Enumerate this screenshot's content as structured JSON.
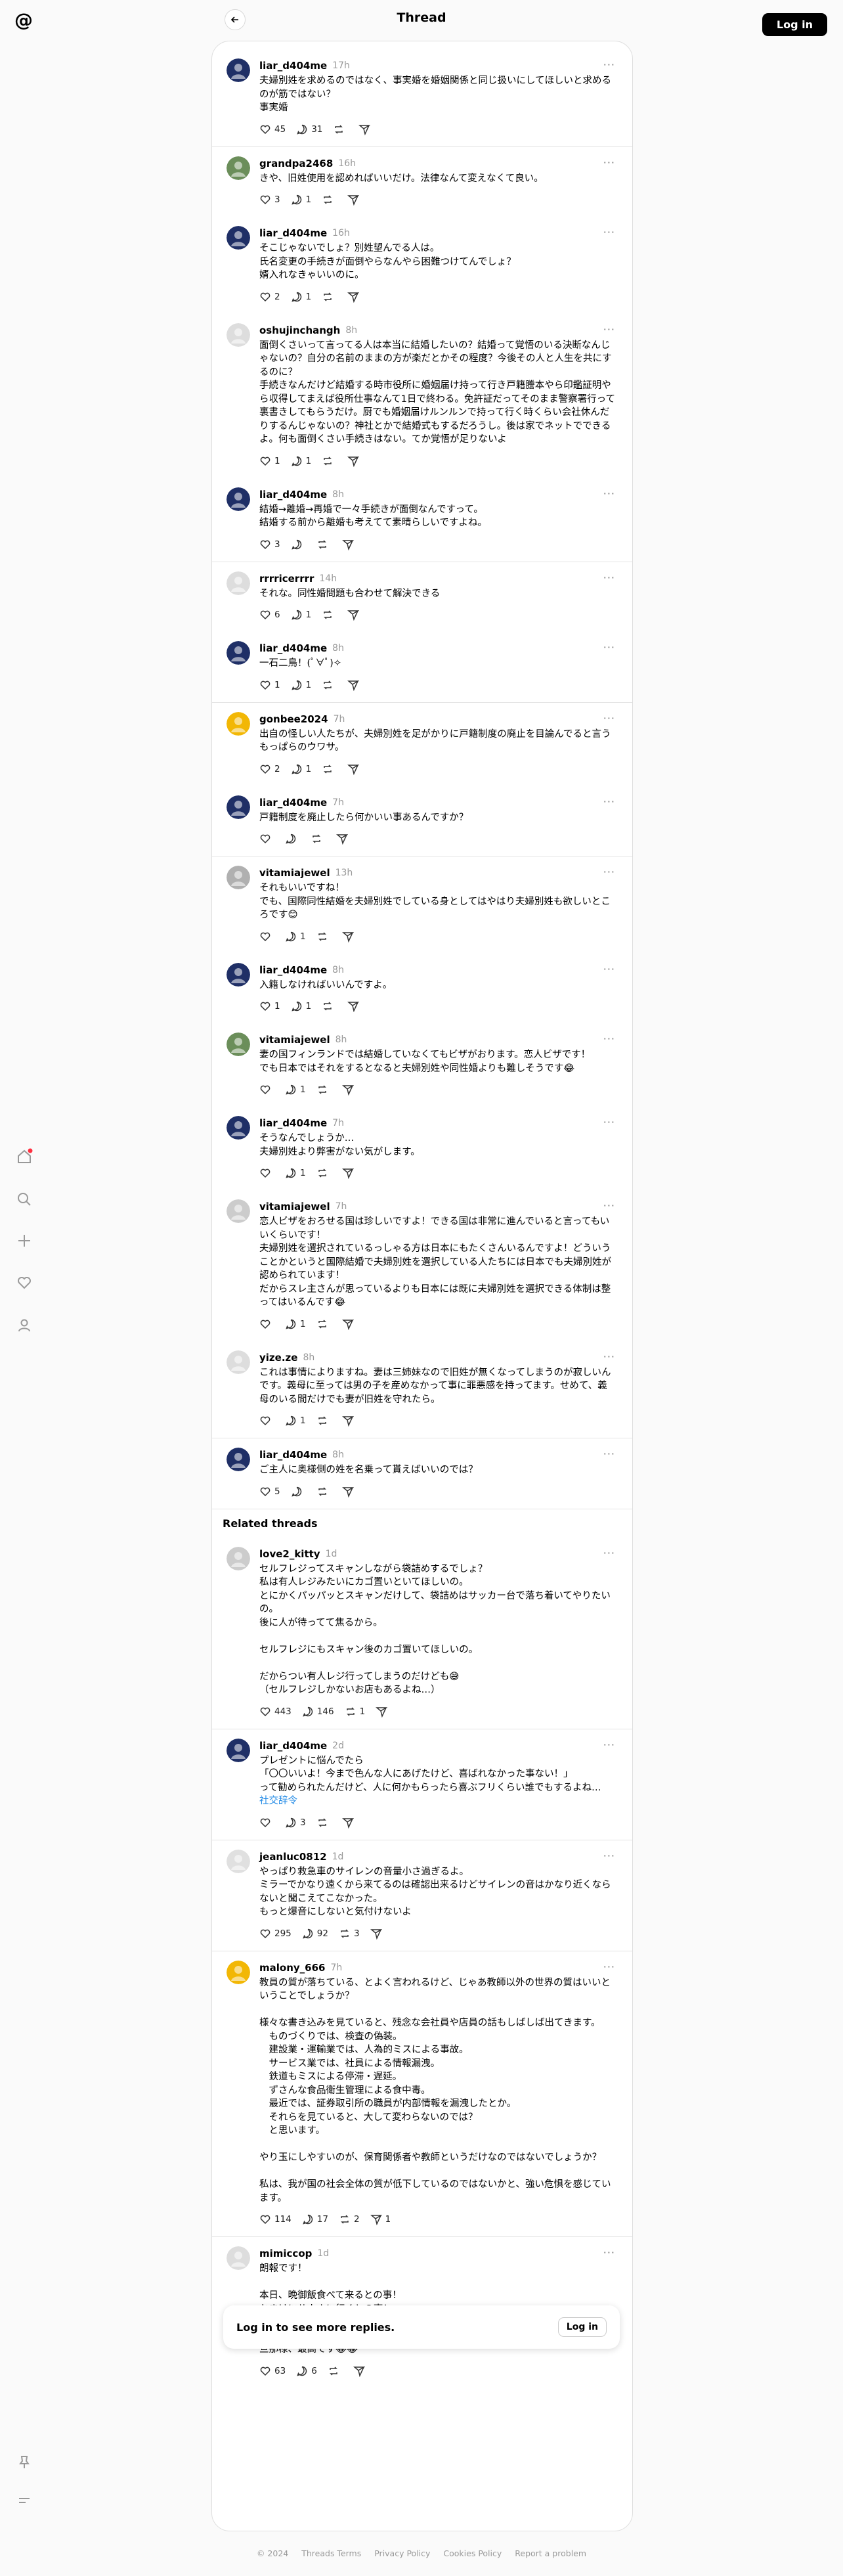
{
  "header": {
    "title": "Thread",
    "login_label": "Log in"
  },
  "colors": {
    "accent": "#000000",
    "link": "#1e88e5",
    "notification": "#ff3040"
  },
  "sidebar_icons": [
    "home-icon",
    "search-icon",
    "create-icon",
    "heart-icon",
    "profile-icon",
    "pin-icon",
    "menu-icon"
  ],
  "thread": [
    {
      "user": "liar_d404me",
      "time": "17h",
      "lines": [
        "夫婦別姓を求めるのではなく、事実婚を婚姻関係と同じ扱いにしてほしいと求めるのが筋ではない？",
        "事実婚"
      ],
      "likes": "45",
      "replies": "31",
      "reposts": "",
      "shares": ""
    },
    {
      "user": "grandpa2468",
      "time": "16h",
      "lines": [
        "きや、旧姓使用を認めればいいだけ。法律なんて変えなくて良い。"
      ],
      "likes": "3",
      "replies": "1",
      "reposts": "",
      "shares": ""
    },
    {
      "user": "liar_d404me",
      "time": "16h",
      "lines": [
        "そこじゃないでしょ？別姓望んでる人は。",
        "氏名変更の手続きが面倒やらなんやら困難つけてんでしょ？",
        "婿入れなきゃいいのに。"
      ],
      "likes": "2",
      "replies": "1",
      "reposts": "",
      "shares": ""
    },
    {
      "user": "oshujinchangh",
      "time": "8h",
      "lines": [
        "面倒くさいって言ってる人は本当に結婚したいの？結婚って覚悟のいる決断なんじゃないの？自分の名前のままの方が楽だとかその程度？今後その人と人生を共にするのに？",
        "手続きなんだけど結婚する時市役所に婚姻届け持って行き戸籍謄本やら印鑑証明やら収得してまえば役所仕事なんて1日で終わる。免許証だってそのまま警察署行って裏書きしてもらうだけ。厨でも婚姻届けルンルンで持って行く時くらい会社休んだりするんじゃないの？神社とかで結婚式もするだろうし。後は家でネットでできるよ。何も面倒くさい手続きはない。てか覚悟が足りないよ"
      ],
      "likes": "1",
      "replies": "1",
      "reposts": "",
      "shares": ""
    },
    {
      "user": "liar_d404me",
      "time": "8h",
      "lines": [
        "結婚→離婚→再婚で一々手続きが面倒なんですって。",
        "結婚する前から離婚も考えてて素晴らしいですよね。"
      ],
      "likes": "3",
      "replies": "",
      "reposts": "",
      "shares": ""
    },
    {
      "user": "rrrricerrrr",
      "time": "14h",
      "lines": [
        "それな。同性婚問題も合わせて解決できる"
      ],
      "likes": "6",
      "replies": "1",
      "reposts": "",
      "shares": ""
    },
    {
      "user": "liar_d404me",
      "time": "8h",
      "lines": [
        "一石二鳥！(ﾟ∀ﾟ)✧"
      ],
      "likes": "1",
      "replies": "1",
      "reposts": "",
      "shares": ""
    },
    {
      "user": "gonbee2024",
      "time": "7h",
      "lines": [
        "出自の怪しい人たちが、夫婦別姓を足がかりに戸籍制度の廃止を目論んでると言うもっぱらのウワサ。"
      ],
      "likes": "2",
      "replies": "1",
      "reposts": "",
      "shares": ""
    },
    {
      "user": "liar_d404me",
      "time": "7h",
      "lines": [
        "戸籍制度を廃止したら何かいい事あるんですか？"
      ],
      "likes": "",
      "replies": "",
      "reposts": "",
      "shares": ""
    },
    {
      "user": "vitamiajewel",
      "time": "13h",
      "lines": [
        "それもいいですね！",
        "でも、国際同性結婚を夫婦別姓でしている身としてはやはり夫婦別姓も欲しいところです😊"
      ],
      "likes": "",
      "replies": "1",
      "reposts": "",
      "shares": ""
    },
    {
      "user": "liar_d404me",
      "time": "8h",
      "lines": [
        "入籍しなければいいんですよ。"
      ],
      "likes": "1",
      "replies": "1",
      "reposts": "",
      "shares": ""
    },
    {
      "user": "vitamiajewel",
      "time": "8h",
      "lines": [
        "妻の国フィンランドでは結婚していなくてもビザがおります。恋人ビザです！",
        "でも日本ではそれをするとなると夫婦別姓や同性婚よりも難しそうです😂"
      ],
      "likes": "",
      "replies": "1",
      "reposts": "",
      "shares": ""
    },
    {
      "user": "liar_d404me",
      "time": "7h",
      "lines": [
        "そうなんでしょうか…",
        "夫婦別姓より弊害がない気がします。"
      ],
      "likes": "",
      "replies": "1",
      "reposts": "",
      "shares": ""
    },
    {
      "user": "vitamiajewel",
      "time": "7h",
      "lines": [
        "恋人ビザをおろせる国は珍しいですよ！できる国は非常に進んでいると言ってもいいくらいです！",
        "夫婦別姓を選択されているっしゃる方は日本にもたくさんいるんですよ！どういうことかというと国際結婚で夫婦別姓を選択している人たちには日本でも夫婦別姓が認められています！",
        "だからスレ主さんが思っているよりも日本には既に夫婦別姓を選択できる体制は整ってはいるんです😂"
      ],
      "likes": "",
      "replies": "1",
      "reposts": "",
      "shares": ""
    },
    {
      "user": "yize.ze",
      "time": "8h",
      "lines": [
        "これは事情によりますね。妻は三姉妹なので旧姓が無くなってしまうのが寂しいんです。義母に至っては男の子を産めなかって事に罪悪感を持ってます。せめて、義母のいる間だけでも妻が旧姓を守れたら。"
      ],
      "likes": "",
      "replies": "1",
      "reposts": "",
      "shares": ""
    },
    {
      "user": "liar_d404me",
      "time": "8h",
      "lines": [
        "ご主人に奥様側の姓を名乗って貰えばいいのでは？"
      ],
      "likes": "5",
      "replies": "",
      "reposts": "",
      "shares": ""
    }
  ],
  "related": {
    "title": "Related threads",
    "posts": [
      {
        "user": "love2_kitty",
        "time": "1d",
        "lines": [
          "セルフレジってスキャンしながら袋詰めするでしょ？",
          "私は有人レジみたいにカゴ置いといてほしいの。",
          "とにかくパッパッとスキャンだけして、袋詰めはサッカー台で落ち着いてやりたいの。",
          "後に人が待ってて焦るから。",
          "",
          "セルフレジにもスキャン後のカゴ置いてほしいの。",
          "",
          "だからつい有人レジ行ってしまうのだけども😅",
          "（セルフレジしかないお店もあるよね…）"
        ],
        "likes": "443",
        "replies": "146",
        "reposts": "1",
        "shares": ""
      },
      {
        "user": "liar_d404me",
        "time": "2d",
        "lines": [
          "プレゼントに悩んでたら",
          "「〇〇いいよ！今まで色んな人にあげたけど、喜ばれなかった事ない！」",
          "って勧められたんだけど、人に何かもらったら喜ぶフリくらい誰でもするよね…"
        ],
        "link": "社交辞令",
        "likes": "",
        "replies": "3",
        "reposts": "",
        "shares": ""
      },
      {
        "user": "jeanluc0812",
        "time": "1d",
        "lines": [
          "やっぱり救急車のサイレンの音量小さ過ぎるよ。",
          "ミラーでかなり遠くから来てるのは確認出来るけどサイレンの音はかなり近くならないと聞こえてこなかった。",
          "もっと爆音にしないと気付けないよ"
        ],
        "likes": "295",
        "replies": "92",
        "reposts": "3",
        "shares": ""
      },
      {
        "user": "malony_666",
        "time": "7h",
        "lines": [
          "教員の質が落ちている、とよく言われるけど、じゃあ教師以外の世界の質はいいということでしょうか？",
          "",
          "様々な書き込みを見ていると、残念な会社員や店員の話もしばしば出てきます。",
          "　ものづくりでは、検査の偽装。",
          "　建設業・運輸業では、人為的ミスによる事故。",
          "　サービス業では、社員による情報漏洩。",
          "　鉄道もミスによる停滞・遅延。",
          "　ずさんな食品衛生管理による食中毒。",
          "　最近では、証券取引所の職員が内部情報を漏洩したとか。",
          "　それらを見ていると、大して変わらないのでは？",
          "　と思います。",
          "",
          "やり玉にしやすいのが、保育関係者や教師というだけなのではないでしょうか？",
          "",
          "私は、我が国の社会全体の質が低下しているのではないかと、強い危惧を感じています。"
        ],
        "likes": "114",
        "replies": "17",
        "reposts": "2",
        "shares": "1"
      },
      {
        "user": "mimiccop",
        "time": "1d",
        "lines": [
          "朗報です！",
          "",
          "本日、晩御飯食べて来るとの事！",
          "おまけにサウナに行くとの事！",
          "",
          "イヤッホォーーーーッ！！！",
          "旦那様、最高です😂😂"
        ],
        "likes": "63",
        "replies": "6",
        "reposts": "",
        "shares": ""
      }
    ]
  },
  "login_card": {
    "text": "Log in to see more replies.",
    "button": "Log in"
  },
  "footer": [
    "© 2024",
    "Threads Terms",
    "Privacy Policy",
    "Cookies Policy",
    "Report a problem"
  ]
}
